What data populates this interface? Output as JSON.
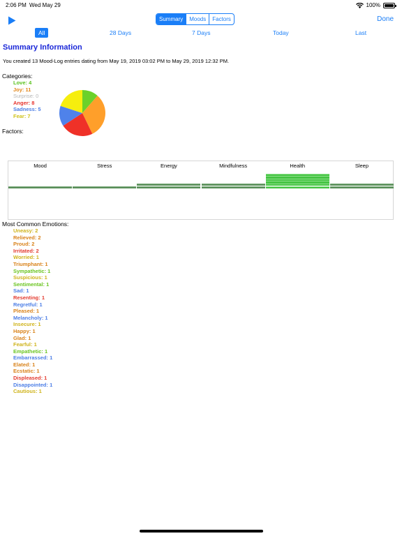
{
  "status": {
    "time": "2:06 PM",
    "date": "Wed May 29",
    "battery": "100%",
    "battery_level": 1.0
  },
  "nav": {
    "tabs": [
      {
        "label": "Summary",
        "active": true
      },
      {
        "label": "Moods",
        "active": false
      },
      {
        "label": "Factors",
        "active": false
      }
    ],
    "done_label": "Done"
  },
  "ranges": [
    "All",
    "28 Days",
    "7 Days",
    "Today",
    "Last"
  ],
  "summary": {
    "title": "Summary Information",
    "text": "You created 13 Mood-Log entries dating from May 19, 2019 03:02 PM to May 29, 2019 12:32 PM."
  },
  "categories": {
    "title": "Categories:",
    "items": [
      {
        "name": "Love",
        "count": 4,
        "color": "#5ac21d"
      },
      {
        "name": "Joy",
        "count": 11,
        "color": "#e2861a"
      },
      {
        "name": "Surprise",
        "count": 0,
        "color": "#b6b6b6"
      },
      {
        "name": "Anger",
        "count": 8,
        "color": "#e7322b"
      },
      {
        "name": "Sadness",
        "count": 5,
        "color": "#4c7ee6"
      },
      {
        "name": "Fear",
        "count": 7,
        "color": "#cfc21a"
      }
    ],
    "pie_colors": {
      "Love": "#6cd12a",
      "Joy": "#ff9f2a",
      "Anger": "#ef3128",
      "Sadness": "#4f82ea",
      "Fear": "#f6ee0e"
    }
  },
  "factors": {
    "title": "Factors:",
    "items": [
      {
        "label": "Mood",
        "level": 1
      },
      {
        "label": "Stress",
        "level": 1
      },
      {
        "label": "Energy",
        "level": 2
      },
      {
        "label": "Mindfulness",
        "level": 2
      },
      {
        "label": "Health",
        "level": 6
      },
      {
        "label": "Sleep",
        "level": 2
      }
    ],
    "colors": {
      "dark": "#5a8f5a",
      "bright": "#45c443"
    }
  },
  "emotions": {
    "title": "Most Common Emotions:",
    "items": [
      {
        "text": "Uneasy: 2",
        "color": "#cfb31a"
      },
      {
        "text": "Relieved: 2",
        "color": "#d9821a"
      },
      {
        "text": "Proud: 2",
        "color": "#d9821a"
      },
      {
        "text": "Irritated: 2",
        "color": "#e33a2e"
      },
      {
        "text": "Worried: 1",
        "color": "#cfb31a"
      },
      {
        "text": "Triumphant: 1",
        "color": "#d9821a"
      },
      {
        "text": "Sympathetic: 1",
        "color": "#6ac41f"
      },
      {
        "text": "Suspicious: 1",
        "color": "#cfb31a"
      },
      {
        "text": "Sentimental: 1",
        "color": "#6ac41f"
      },
      {
        "text": "Sad: 1",
        "color": "#4c7ee6"
      },
      {
        "text": "Resenting: 1",
        "color": "#e33a2e"
      },
      {
        "text": "Regretful: 1",
        "color": "#4c7ee6"
      },
      {
        "text": "Pleased: 1",
        "color": "#d9821a"
      },
      {
        "text": "Melancholy: 1",
        "color": "#4c7ee6"
      },
      {
        "text": "Insecure: 1",
        "color": "#cfb31a"
      },
      {
        "text": "Happy: 1",
        "color": "#d9821a"
      },
      {
        "text": "Glad: 1",
        "color": "#d9821a"
      },
      {
        "text": "Fearful: 1",
        "color": "#cfb31a"
      },
      {
        "text": "Empathetic: 1",
        "color": "#6ac41f"
      },
      {
        "text": "Embarrassed: 1",
        "color": "#4c7ee6"
      },
      {
        "text": "Elated: 1",
        "color": "#d9821a"
      },
      {
        "text": "Ecstatic: 1",
        "color": "#d9821a"
      },
      {
        "text": "Displeased: 1",
        "color": "#e33a2e"
      },
      {
        "text": "Disappointed: 1",
        "color": "#4c7ee6"
      },
      {
        "text": "Cautious: 1",
        "color": "#cfb31a"
      }
    ]
  },
  "icons": {
    "play": "play-icon",
    "wifi": "wifi-icon",
    "battery": "battery-icon"
  },
  "colors": {
    "accent": "#1a7ef7",
    "title": "#1a27d8"
  }
}
